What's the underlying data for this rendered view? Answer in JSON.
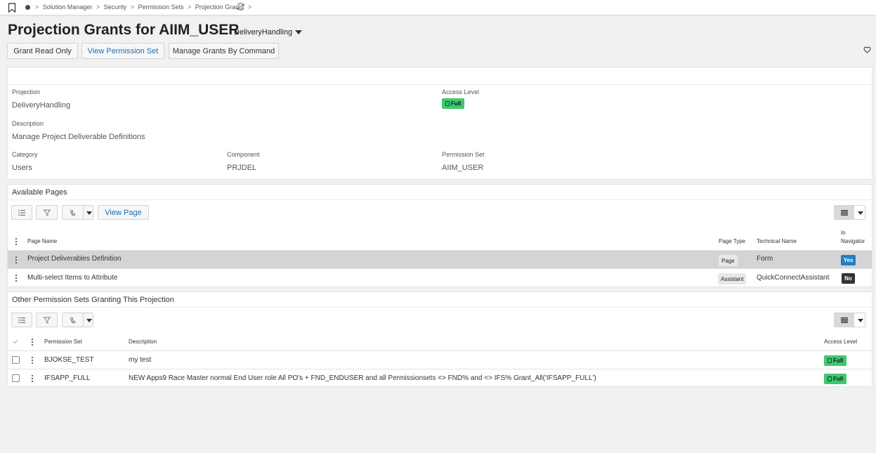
{
  "breadcrumb": {
    "items": [
      "Solution Manager",
      "Security",
      "Permission Sets",
      "Projection Grants"
    ],
    "separator": ">"
  },
  "header": {
    "title": "Projection Grants for AIIM_USER",
    "subtitle": "DeliveryHandling"
  },
  "commands": {
    "grant_read_only": "Grant Read Only",
    "view_permission_set": "View Permission Set",
    "manage_grants": "Manage Grants By Command"
  },
  "details": {
    "projection_label": "Projection",
    "projection_value": "DeliveryHandling",
    "access_level_label": "Access Level",
    "access_level_value": "Full",
    "description_label": "Description",
    "description_value": "Manage Project Deliverable Definitions",
    "category_label": "Category",
    "category_value": "Users",
    "component_label": "Component",
    "component_value": "PRJDEL",
    "permission_set_label": "Permission Set",
    "permission_set_value": "AIIM_USER"
  },
  "available_pages": {
    "title": "Available Pages",
    "view_page_label": "View Page",
    "columns": {
      "page_name": "Page Name",
      "page_type": "Page Type",
      "technical_name": "Technical Name",
      "in_navigator_1": "In",
      "in_navigator_2": "Navigator"
    },
    "rows": [
      {
        "page_name": "Project Deliverables Definition",
        "page_type": "Page",
        "technical_name": "Form",
        "in_navigator": "Yes"
      },
      {
        "page_name": "Multi-select Items to Attribute",
        "page_type": "Assistant",
        "technical_name": "QuickConnectAssistant",
        "in_navigator": "No"
      }
    ]
  },
  "other_sets": {
    "title": "Other Permission Sets Granting This Projection",
    "columns": {
      "permission_set": "Permission Set",
      "description": "Description",
      "access_level": "Access Level"
    },
    "rows": [
      {
        "permission_set": "BJOKSE_TEST",
        "description": "my test",
        "access_level": "Full"
      },
      {
        "permission_set": "IFSAPP_FULL",
        "description": "NEW Apps9 Race Master normal End User role All PO's + FND_ENDUSER and all Permissionsets <> FND% and <> IFS% Grant_All('IFSAPP_FULL')",
        "access_level": "Full"
      }
    ]
  },
  "colors": {
    "accent": "#1a6fb0",
    "full_badge": "#3ec96d",
    "yes_badge": "#1f7fc2",
    "no_badge": "#333333",
    "selected_row": "#d4d4d6"
  }
}
